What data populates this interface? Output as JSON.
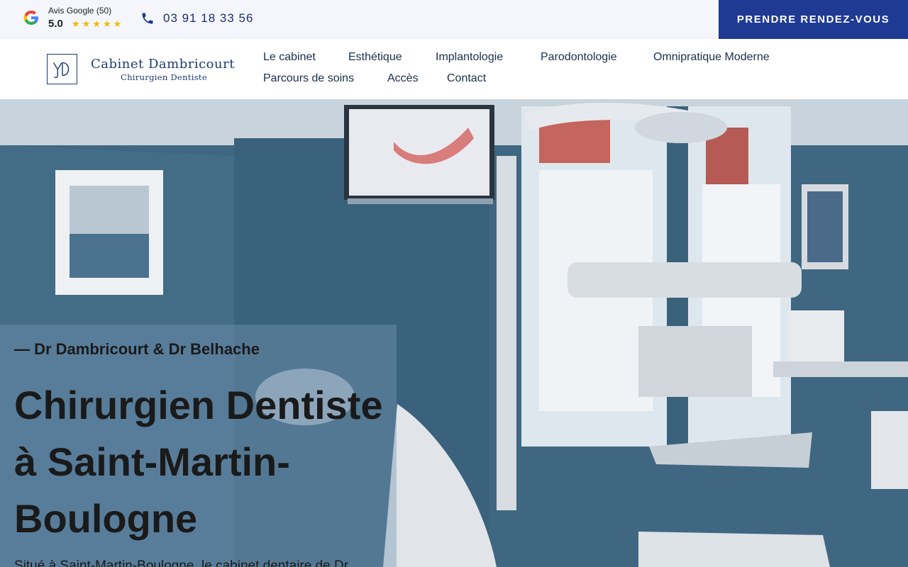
{
  "topbar": {
    "review_label": "Avis Google (50)",
    "review_score": "5.0",
    "stars": "★★★★★",
    "phone": "03 91 18 33 56",
    "cta_label": "PRENDRE RENDEZ-VOUS",
    "icons": {
      "google": "google-icon",
      "phone": "phone-icon",
      "star": "star-icon"
    }
  },
  "header": {
    "logo_name": "Cabinet Dambricourt",
    "logo_sub": "Chirurgien Dentiste",
    "nav": [
      "Le cabinet",
      "Esthétique",
      "Implantologie",
      "Parodontologie",
      "Omnipratique Moderne",
      "Parcours de soins",
      "Accès",
      "Contact"
    ]
  },
  "hero": {
    "eyebrow": "— Dr Dambricourt & Dr Belhache",
    "title": "Chirurgien Dentiste à Saint-Martin-Boulogne",
    "text": "Situé à Saint-Martin-Boulogne, le cabinet dentaire de Dr"
  },
  "colors": {
    "cta_bg": "#1f3a93",
    "brand_navy": "#1f3a73",
    "star": "#f2b705",
    "topbar_bg": "#f4f6fb",
    "wall": "#3f6781"
  }
}
